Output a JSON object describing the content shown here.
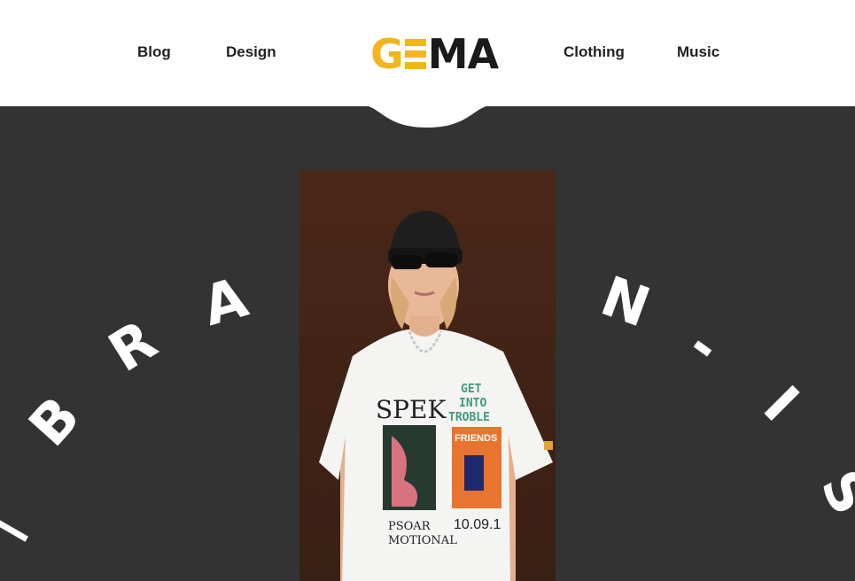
{
  "header": {
    "nav_left": [
      "Blog",
      "Design"
    ],
    "nav_right": [
      "Clothing",
      "Music"
    ],
    "logo": {
      "first": "G",
      "rest": "MA",
      "accent_color": "#f2b51c",
      "dark_color": "#1a1a1a"
    }
  },
  "hero": {
    "background": "#333333",
    "rotating_text_visible": [
      "B",
      "R",
      "A",
      "N",
      "-",
      "I",
      "S"
    ],
    "photo": {
      "shirt_texts": [
        "SPEK",
        "GET",
        "INTO",
        "TROBLE",
        "FRIENDS",
        "PSOAR",
        "MOTIONAL",
        "10.09.1"
      ]
    }
  }
}
